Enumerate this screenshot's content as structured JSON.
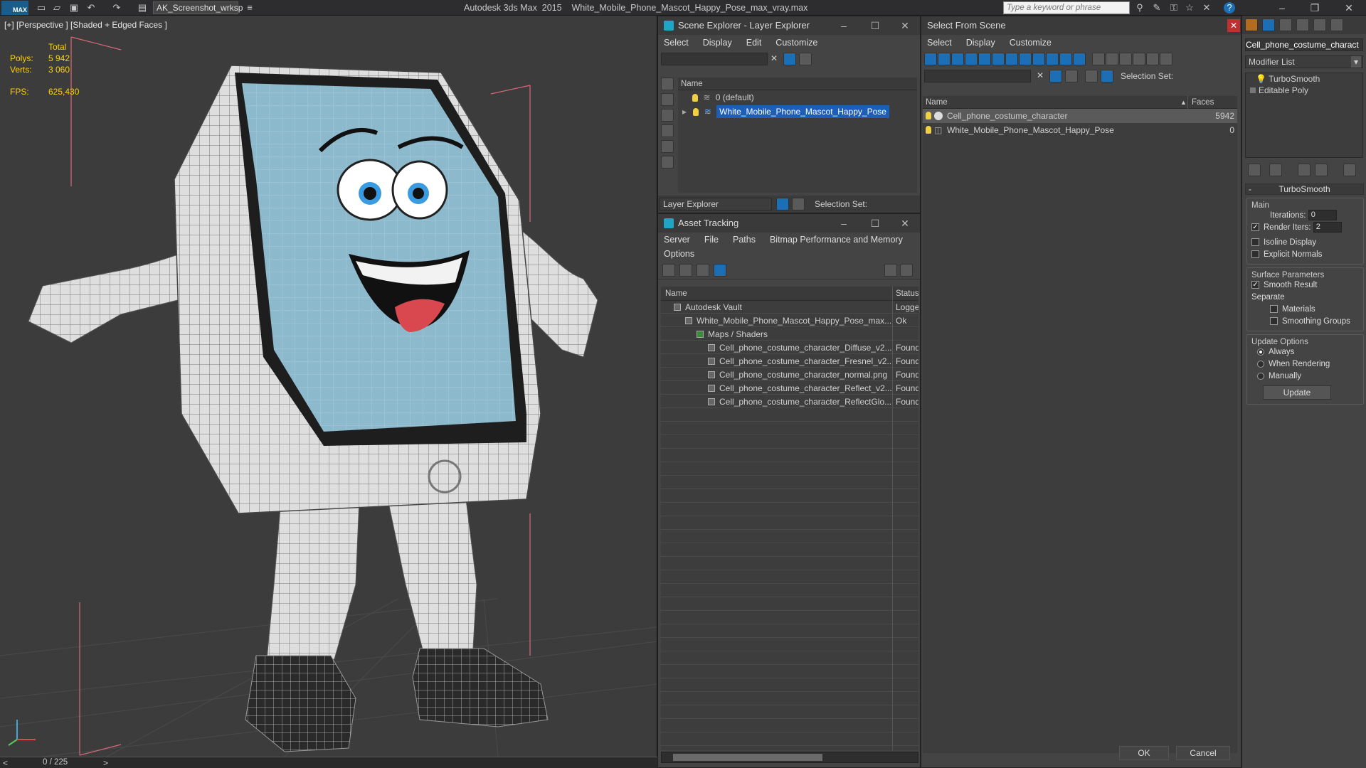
{
  "app": {
    "title": "Autodesk 3ds Max  2015    White_Mobile_Phone_Mascot_Happy_Pose_max_vray.max",
    "logo": "MAX",
    "workspace": "AK_Screenshot_wrksp",
    "search_placeholder": "Type a keyword or phrase"
  },
  "viewport": {
    "label": "[+] [Perspective ] [Shaded + Edged Faces ]",
    "stats": {
      "total_label": "Total",
      "polys_label": "Polys:",
      "polys": "5 942",
      "verts_label": "Verts:",
      "verts": "3 060",
      "fps_label": "FPS:",
      "fps": "625,430"
    },
    "frame": "0 / 225",
    "prev": "<",
    "next": ">"
  },
  "scene_explorer": {
    "title": "Scene Explorer - Layer Explorer",
    "menus": [
      "Select",
      "Display",
      "Edit",
      "Customize"
    ],
    "column": "Name",
    "rows": [
      {
        "name": "0 (default)",
        "selected": false
      },
      {
        "name": "White_Mobile_Phone_Mascot_Happy_Pose",
        "selected": true
      }
    ],
    "footer_dropdown": "Layer Explorer",
    "selection_set": "Selection Set:"
  },
  "asset_tracking": {
    "title": "Asset Tracking",
    "menus": [
      "Server",
      "File",
      "Paths",
      "Bitmap Performance and Memory",
      "Options"
    ],
    "columns": [
      "Name",
      "Status"
    ],
    "rows": [
      {
        "name": "Autodesk Vault",
        "status": "Logge",
        "indent": 0
      },
      {
        "name": "White_Mobile_Phone_Mascot_Happy_Pose_max...",
        "status": "Ok",
        "indent": 1
      },
      {
        "name": "Maps / Shaders",
        "status": "",
        "indent": 2
      },
      {
        "name": "Cell_phone_costume_character_Diffuse_v2...",
        "status": "Found",
        "indent": 3
      },
      {
        "name": "Cell_phone_costume_character_Fresnel_v2...",
        "status": "Found",
        "indent": 3
      },
      {
        "name": "Cell_phone_costume_character_normal.png",
        "status": "Found",
        "indent": 3
      },
      {
        "name": "Cell_phone_costume_character_Reflect_v2...",
        "status": "Found",
        "indent": 3
      },
      {
        "name": "Cell_phone_costume_character_ReflectGlo...",
        "status": "Found",
        "indent": 3
      }
    ]
  },
  "select_from_scene": {
    "title": "Select From Scene",
    "menus": [
      "Select",
      "Display",
      "Customize"
    ],
    "selection_set": "Selection Set:",
    "columns": [
      "Name",
      "Faces"
    ],
    "rows": [
      {
        "name": "Cell_phone_costume_character",
        "faces": "5942",
        "selected": true
      },
      {
        "name": "White_Mobile_Phone_Mascot_Happy_Pose",
        "faces": "0",
        "selected": false
      }
    ],
    "ok": "OK",
    "cancel": "Cancel"
  },
  "command_panel": {
    "object_name": "Cell_phone_costume_charact",
    "modifier_list": "Modifier List",
    "stack": [
      "TurboSmooth",
      "Editable Poly"
    ],
    "rollout": "TurboSmooth",
    "main_label": "Main",
    "iterations_label": "Iterations:",
    "iterations": "0",
    "render_iters_label": "Render Iters:",
    "render_iters": "2",
    "isoline": "Isoline Display",
    "explicit_normals": "Explicit Normals",
    "surface_params": "Surface Parameters",
    "smooth_result": "Smooth Result",
    "separate": "Separate",
    "materials": "Materials",
    "smoothing_groups": "Smoothing Groups",
    "update_options": "Update Options",
    "always": "Always",
    "when_rendering": "When Rendering",
    "manually": "Manually",
    "update": "Update"
  },
  "colors": {
    "selection": "#1d5fb8",
    "stats": "#ffd400",
    "screen": "#8ab4c8"
  }
}
